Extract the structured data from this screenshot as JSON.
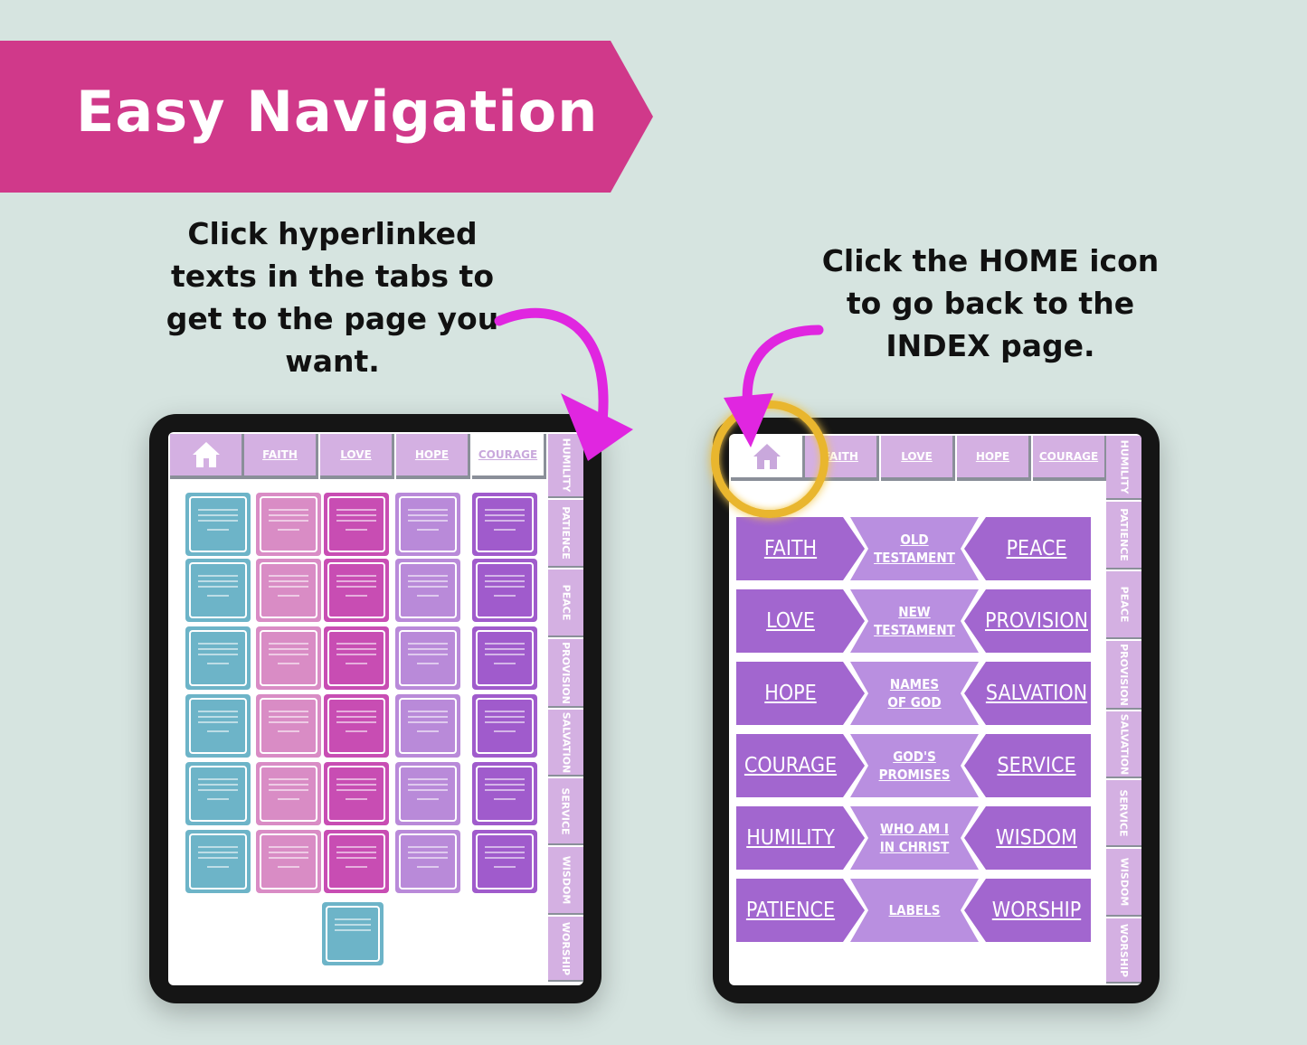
{
  "banner": {
    "title": "Easy Navigation"
  },
  "captions": {
    "left": "Click hyperlinked\ntexts in the tabs to\nget to the page you\nwant.",
    "right": "Click the HOME icon\nto go back to the\nINDEX page."
  },
  "colors": {
    "background": "#d6e4e0",
    "banner": "#d0398a",
    "arrow": "#e026e0",
    "tab": "#d4b0e2",
    "highlight_ring": "#e9b62e"
  },
  "top_tabs": [
    {
      "icon": "home-icon"
    },
    {
      "label": "FAITH"
    },
    {
      "label": "LOVE"
    },
    {
      "label": "HOPE"
    },
    {
      "label": "COURAGE"
    }
  ],
  "side_tabs": [
    "HUMILITY",
    "PATIENCE",
    "PEACE",
    "PROVISION",
    "SALVATION",
    "SERVICE",
    "WISDOM",
    "WORSHIP"
  ],
  "left_tablet": {
    "active_tab": "COURAGE",
    "card_colors": [
      "#6db4c8",
      "#d98cc5",
      "#c84db3",
      "#b98ad9",
      "#a05bcc"
    ]
  },
  "right_tablet": {
    "active_tab": "home",
    "index": [
      {
        "left": "FAITH",
        "center": "OLD\nTESTAMENT",
        "right": "PEACE"
      },
      {
        "left": "LOVE",
        "center": "NEW\nTESTAMENT",
        "right": "PROVISION"
      },
      {
        "left": "HOPE",
        "center": "NAMES\nOF GOD",
        "right": "SALVATION"
      },
      {
        "left": "COURAGE",
        "center": "GOD'S\nPROMISES",
        "right": "SERVICE"
      },
      {
        "left": "HUMILITY",
        "center": "WHO AM I\nIN CHRIST",
        "right": "WISDOM"
      },
      {
        "left": "PATIENCE",
        "center": "LABELS",
        "right": "WORSHIP"
      }
    ]
  }
}
